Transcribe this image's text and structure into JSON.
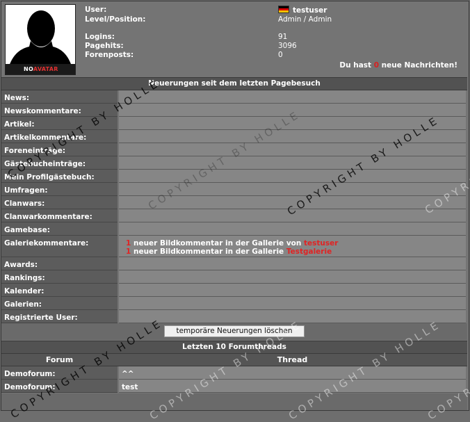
{
  "profile": {
    "avatar_text_no": "NO",
    "avatar_text_avatar": "AVATAR",
    "user_label": "User:",
    "user_value": "testuser",
    "level_label": "Level/Position:",
    "level_value": "Admin / Admin",
    "logins_label": "Logins:",
    "logins_value": "91",
    "pagehits_label": "Pagehits:",
    "pagehits_value": "3096",
    "forenposts_label": "Forenposts:",
    "forenposts_value": "0",
    "messages_pre": "Du hast ",
    "messages_count": "0",
    "messages_post": " neue Nachrichten!"
  },
  "updates": {
    "title": "Neuerungen seit dem letzten Pagebesuch",
    "rows": [
      {
        "label": "News:"
      },
      {
        "label": "Newskommentare:"
      },
      {
        "label": "Artikel:"
      },
      {
        "label": "Artikelkommentare:"
      },
      {
        "label": "Foreneinträge:"
      },
      {
        "label": "Gästebucheinträge:"
      },
      {
        "label": "Mein Profilgästebuch:"
      },
      {
        "label": "Umfragen:"
      },
      {
        "label": "Clanwars:"
      },
      {
        "label": "Clanwarkommentare:"
      },
      {
        "label": "Gamebase:"
      },
      {
        "label": "Galeriekommentare:"
      },
      {
        "label": "Awards:"
      },
      {
        "label": "Rankings:"
      },
      {
        "label": "Kalender:"
      },
      {
        "label": "Galerien:"
      },
      {
        "label": "Registrierte User:"
      }
    ],
    "gallery_comments": [
      {
        "count": "1",
        "text": " neuer Bildkommentar in der Gallerie von ",
        "link": "testuser"
      },
      {
        "count": "1",
        "text": " neuer Bildkommentar in der Gallerie ",
        "link": "Testgalerie"
      }
    ],
    "clear_button": "temporäre Neuerungen löschen"
  },
  "threads": {
    "title": "Letzten 10 Forumthreads",
    "col_forum": "Forum",
    "col_thread": "Thread",
    "rows": [
      {
        "forum": "Demoforum:",
        "thread": "^^"
      },
      {
        "forum": "Demoforum:",
        "thread": "test"
      }
    ]
  },
  "watermark": "COPYRIGHT BY HOLLE",
  "colors": {
    "accent_red": "#e02424",
    "panel": "#747474",
    "row_value": "#868686",
    "row_label": "#5c5c5c"
  }
}
